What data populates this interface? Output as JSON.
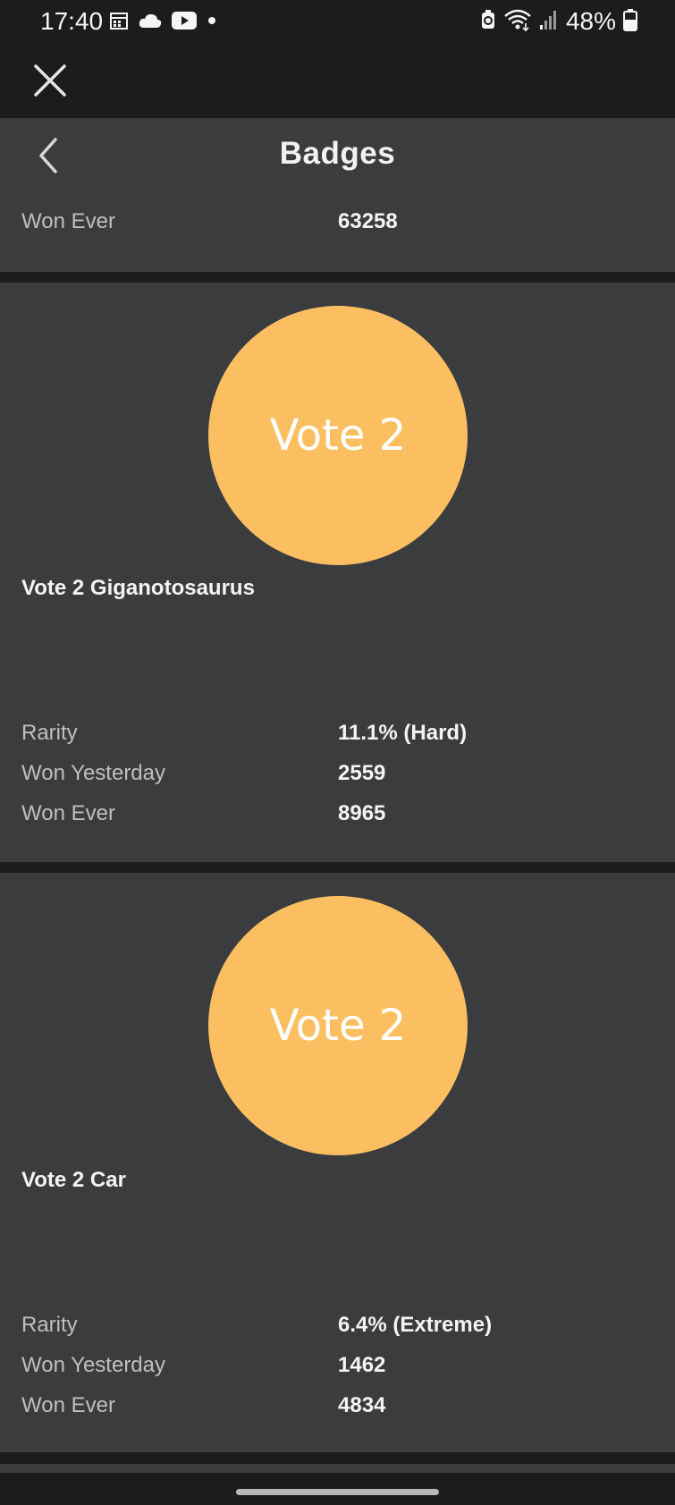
{
  "status_bar": {
    "time": "17:40",
    "battery_percent": "48%",
    "left_icons": [
      "calendar-icon",
      "cloud-icon",
      "youtube-icon",
      "dot-icon"
    ],
    "right_icons": [
      "battery-saver-icon",
      "wifi-icon",
      "signal-icon",
      "battery-icon"
    ]
  },
  "header": {
    "title": "Badges"
  },
  "top_card": {
    "won_ever_label": "Won Ever",
    "won_ever_value": "63258"
  },
  "badges": [
    {
      "circle_text": "Vote 2",
      "name": "Vote 2 Giganotosaurus",
      "rarity_label": "Rarity",
      "rarity_value": "11.1% (Hard)",
      "won_yesterday_label": "Won Yesterday",
      "won_yesterday_value": "2559",
      "won_ever_label": "Won Ever",
      "won_ever_value": "8965"
    },
    {
      "circle_text": "Vote 2",
      "name": "Vote 2 Car",
      "rarity_label": "Rarity",
      "rarity_value": "6.4% (Extreme)",
      "won_yesterday_label": "Won Yesterday",
      "won_yesterday_value": "1462",
      "won_ever_label": "Won Ever",
      "won_ever_value": "4834"
    }
  ],
  "colors": {
    "background": "#1b1c1e",
    "card": "#3b3c3e",
    "badge": "#fbbf62"
  }
}
